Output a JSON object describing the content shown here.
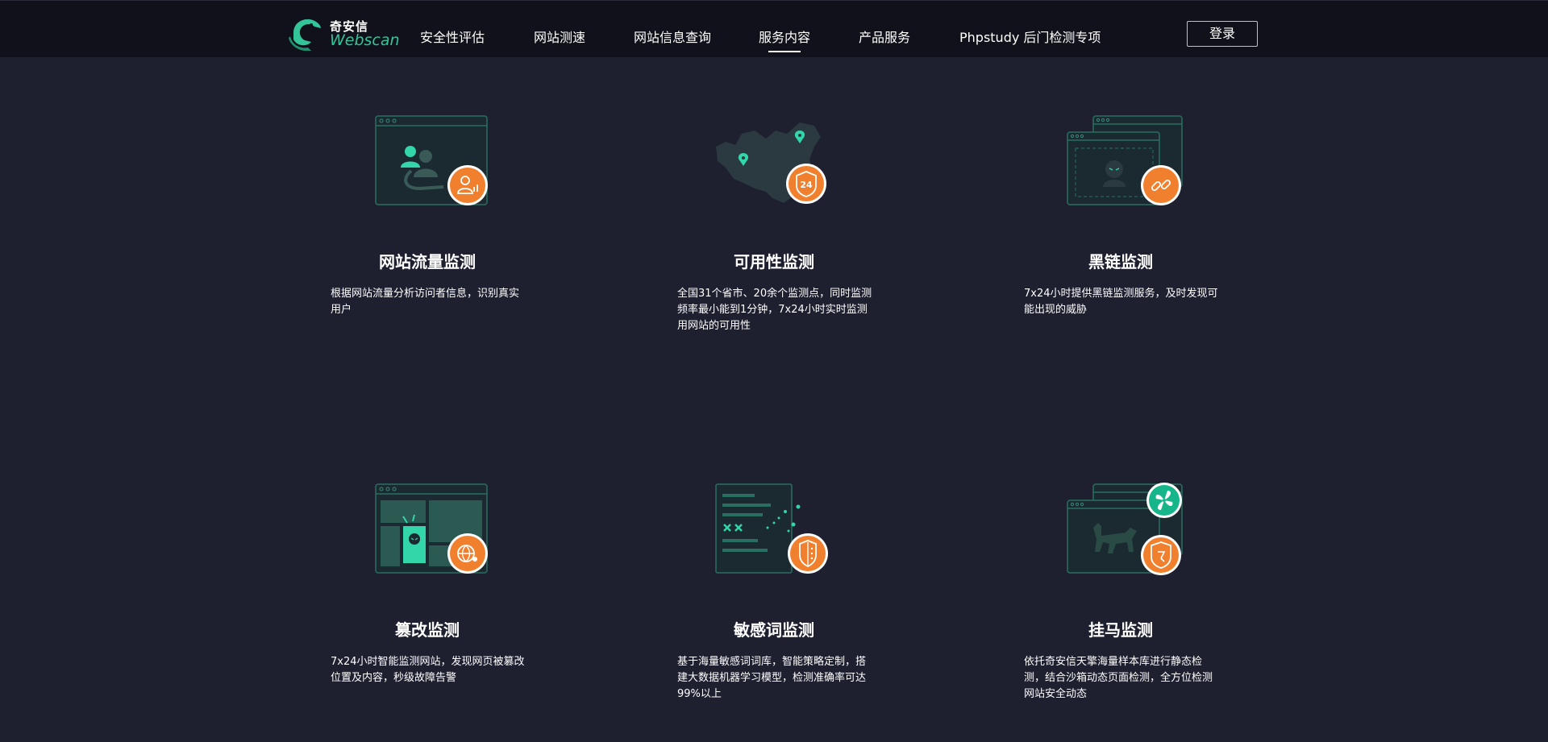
{
  "nav": {
    "logo_cn": "奇安信",
    "logo_en": "Webscan",
    "items": [
      {
        "label": "安全性评估"
      },
      {
        "label": "网站测速"
      },
      {
        "label": "网站信息查询"
      },
      {
        "label": "服务内容",
        "active": true
      },
      {
        "label": "产品服务"
      },
      {
        "label": "Phpstudy 后门检测专项"
      }
    ],
    "login_label": "登录"
  },
  "colors": {
    "background": "#1e1f2f",
    "nav_bg": "#10111a",
    "accent_green": "#33c49a",
    "accent_orange": "#f0802e"
  },
  "services": [
    {
      "title": "网站流量监测",
      "desc": "根据网站流量分析访问者信息，识别真实用户",
      "icon": "traffic-monitor-icon"
    },
    {
      "title": "可用性监测",
      "desc": "全国31个省市、20余个监测点，同时监测频率最小能到1分钟，7x24小时实时监测用网站的可用性",
      "icon": "availability-monitor-icon",
      "badge": "24"
    },
    {
      "title": "黑链监测",
      "desc": "7x24小时提供黑链监测服务，及时发现可能出现的威胁",
      "icon": "black-link-monitor-icon"
    },
    {
      "title": "篡改监测",
      "desc": "7x24小时智能监测网站，发现网页被篡改位置及内容，秒级故障告警",
      "icon": "tamper-monitor-icon"
    },
    {
      "title": "敏感词监测",
      "desc": "基于海量敏感词词库，智能策略定制，搭建大数据机器学习模型，检测准确率可达99%以上",
      "icon": "sensitive-word-monitor-icon"
    },
    {
      "title": "挂马监测",
      "desc": "依托奇安信天擎海量样本库进行静态检测，结合沙箱动态页面检测，全方位检测网站安全动态",
      "icon": "trojan-monitor-icon"
    }
  ]
}
